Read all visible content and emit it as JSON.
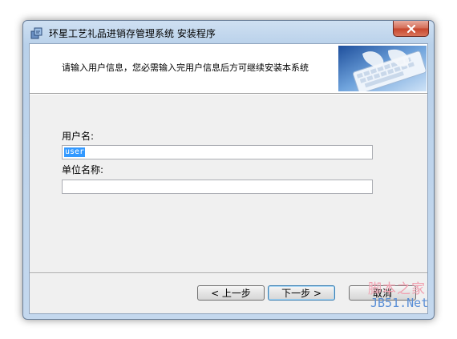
{
  "window": {
    "title": "环星工艺礼品进销存管理系统 安装程序"
  },
  "banner": {
    "text": "请输入用户信息，您必需输入完用户信息后方可继续安装本系统"
  },
  "form": {
    "username_label": "用户名:",
    "username_value": "user",
    "company_label": "单位名称:",
    "company_value": ""
  },
  "buttons": {
    "back": "< 上一步",
    "next": "下一步 >",
    "cancel": "取消"
  },
  "watermark": {
    "line1": "脚本之家",
    "line2": "JB51.Net"
  },
  "icons": {
    "app": "installer-icon",
    "close": "close-icon",
    "banner": "keyboard-hands-image"
  },
  "colors": {
    "selection": "#3399ff",
    "close_button": "#c7452c"
  }
}
